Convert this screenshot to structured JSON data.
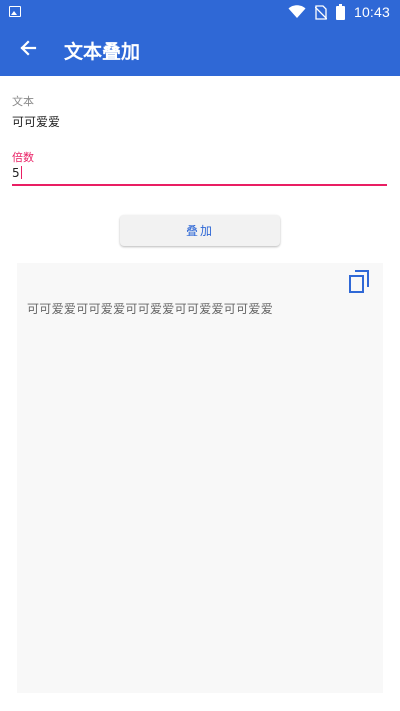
{
  "status_bar": {
    "time": "10:43",
    "icons": [
      "image-icon",
      "wifi-icon",
      "no-sim-icon",
      "battery-icon"
    ],
    "color": "#2f68d6"
  },
  "app_bar": {
    "title": "文本叠加",
    "back_icon": "arrow-back-icon",
    "color": "#2f68d6"
  },
  "form": {
    "text_label": "文本",
    "text_value": "可可爱爱",
    "times_label": "倍数",
    "times_value": "5",
    "accent_color": "#e91e63"
  },
  "actions": {
    "overlay_label": "叠加"
  },
  "result": {
    "text": "可可爱爱可可爱爱可可爱爱可可爱爱可可爱爱",
    "copy_icon": "copy-icon"
  }
}
